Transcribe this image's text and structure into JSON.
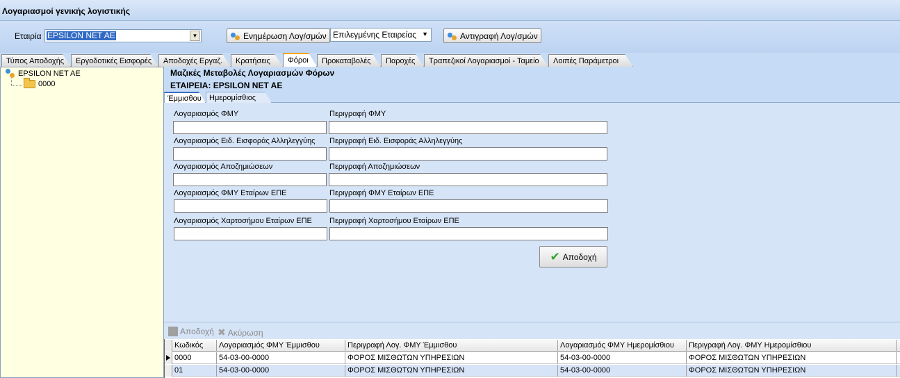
{
  "window": {
    "title": "Λογαριασμοί γενικής λογιστικής"
  },
  "toolbar": {
    "company_label": "Εταιρία",
    "company_value": "EPSILON NET AE",
    "update_button": "Ενημέρωση Λογ/σμών",
    "scope_select": "Επιλεγμένης Εταιρείας",
    "copy_button": "Αντιγραφή Λογ/σμών"
  },
  "tabs": [
    {
      "label": "Τύπος Αποδοχής"
    },
    {
      "label": "Εργοδοτικές Εισφορές"
    },
    {
      "label": "Αποδοχές Εργαζ."
    },
    {
      "label": "Κρατήσεις"
    },
    {
      "label": "Φόροι"
    },
    {
      "label": "Προκαταβολές"
    },
    {
      "label": "Παροχές"
    },
    {
      "label": "Τραπεζικοί Λογαριασμοί - Ταμείο"
    },
    {
      "label": "Λοιπές Παράμετροι"
    }
  ],
  "tree": {
    "root": "EPSILON NET AE",
    "child": "0000"
  },
  "panel": {
    "title": "Μαζικές Μεταβολές Λογαριασμών Φόρων",
    "company_line": "ΕΤΑΙΡΕΙΑ: EPSILON NET AE",
    "subtabs": [
      {
        "label": "Έμμισθου"
      },
      {
        "label": "Ημερομίσθιος"
      }
    ],
    "fields": [
      {
        "account_label": "Λογαριασμός ΦΜΥ",
        "desc_label": "Περιγραφή ΦΜΥ",
        "account_value": "",
        "desc_value": ""
      },
      {
        "account_label": "Λογαριασμός Ειδ. Εισφοράς Αλληλεγγύης",
        "desc_label": "Περιγραφή Ειδ. Εισφοράς Αλληλεγγύης",
        "account_value": "",
        "desc_value": ""
      },
      {
        "account_label": "Λογαριασμός Αποζημιώσεων",
        "desc_label": "Περιγραφή Αποζημιώσεων",
        "account_value": "",
        "desc_value": ""
      },
      {
        "account_label": "Λογαριασμός ΦΜΥ Εταίρων ΕΠΕ",
        "desc_label": "Περιγραφή ΦΜΥ Εταίρων ΕΠΕ",
        "account_value": "",
        "desc_value": ""
      },
      {
        "account_label": "Λογαριασμός Χαρτοσήμου Εταίρων ΕΠΕ",
        "desc_label": "Περιγραφή Χαρτοσήμου Εταίρων ΕΠΕ",
        "account_value": "",
        "desc_value": ""
      }
    ],
    "accept_button": "Αποδοχή"
  },
  "grid_toolbar": {
    "accept": "Αποδοχή",
    "cancel": "Ακύρωση"
  },
  "grid": {
    "columns": [
      "Κωδικός",
      "Λογαριασμός ΦΜΥ Έμμισθου",
      "Περιγραφή Λογ. ΦΜΥ Έμμισθου",
      "Λογαριασμός ΦΜΥ Ημερομίσθιου",
      "Περιγραφή Λογ. ΦΜΥ Ημερομίσθιου"
    ],
    "rows": [
      [
        "0000",
        "54-03-00-0000",
        "ΦΟΡΟΣ ΜΙΣΘΩΤΩΝ ΥΠΗΡΕΣΙΩΝ",
        "54-03-00-0000",
        "ΦΟΡΟΣ ΜΙΣΘΩΤΩΝ ΥΠΗΡΕΣΙΩΝ"
      ],
      [
        "01",
        "54-03-00-0000",
        "ΦΟΡΟΣ ΜΙΣΘΩΤΩΝ ΥΠΗΡΕΣΙΩΝ",
        "54-03-00-0000",
        "ΦΟΡΟΣ ΜΙΣΘΩΤΩΝ ΥΠΗΡΕΣΙΩΝ"
      ]
    ]
  },
  "colors": {
    "accent": "#316ac5",
    "tab_active_marker": "#f4a300",
    "panel_bg": "#c6dbf5",
    "tree_bg": "#ffffe1"
  }
}
